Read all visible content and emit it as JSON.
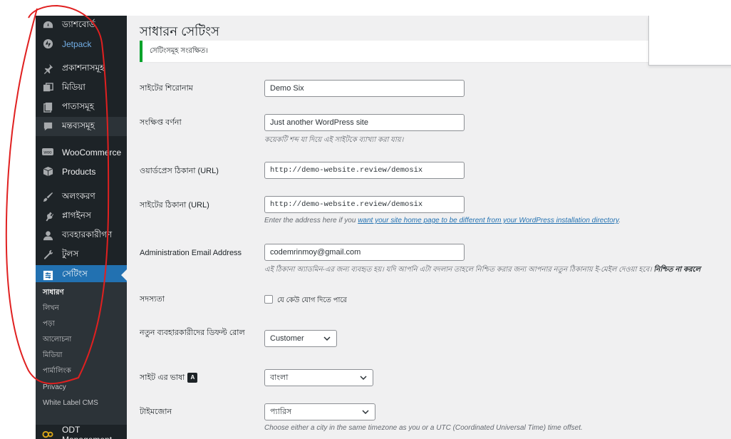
{
  "sidebar": {
    "items": [
      {
        "label": "ড্যাশবোর্ড",
        "icon": "dashboard-icon"
      },
      {
        "label": "Jetpack",
        "icon": "jetpack-icon"
      },
      {
        "label": "প্রকাশনাসমূহ",
        "icon": "pin-icon"
      },
      {
        "label": "মিডিয়া",
        "icon": "media-icon"
      },
      {
        "label": "পাতাসমূহ",
        "icon": "pages-icon"
      },
      {
        "label": "মন্তব্যসমূহ",
        "icon": "comments-icon"
      },
      {
        "label": "WooCommerce",
        "icon": "woocommerce-icon"
      },
      {
        "label": "Products",
        "icon": "products-icon"
      },
      {
        "label": "অলংকরণ",
        "icon": "appearance-icon"
      },
      {
        "label": "প্লাগইনস",
        "icon": "plugins-icon"
      },
      {
        "label": "ব্যবহারকারীগণ",
        "icon": "users-icon"
      },
      {
        "label": "টুলস",
        "icon": "tools-icon"
      },
      {
        "label": "সেটিংস",
        "icon": "settings-icon"
      },
      {
        "label": "ODT Management",
        "icon": "odt-icon"
      }
    ],
    "submenu": [
      "সাধারণ",
      "লিখন",
      "পড়া",
      "আলোচনা",
      "মিডিয়া",
      "পার্মালিংক",
      "Privacy",
      "White Label CMS"
    ]
  },
  "page": {
    "title": "সাধারন সেটিংস",
    "notice": "সেটিংসমূহ সংরক্ষিত।"
  },
  "form": {
    "site_title": {
      "label": "সাইটের শিরোনাম",
      "value": "Demo Six"
    },
    "tagline": {
      "label": "সংক্ষিপ্ত বর্ণনা",
      "value": "Just another WordPress site",
      "desc": "কয়েকটি শব্দ যা দিয়ে এই সাইটকে ব্যাখ্যা করা যায়।"
    },
    "wp_url": {
      "label": "ওয়ার্ডপ্রেস ঠিকানা (URL)",
      "value": "http://demo-website.review/demosix"
    },
    "site_url": {
      "label": "সাইটের ঠিকানা (URL)",
      "value": "http://demo-website.review/demosix",
      "desc_prefix": "Enter the address here if you ",
      "desc_link": "want your site home page to be different from your WordPress installation directory",
      "desc_suffix": "."
    },
    "admin_email": {
      "label": "Administration Email Address",
      "value": "codemrinmoy@gmail.com",
      "desc": "এই ঠিকানা অ্যাডমিন-এর জন্য ব্যবহৃত হয়। যদি আপনি এটা বদলান তাহলে নিশ্চিত করার জন্য আপনার নতুন ঠিকানায় ই-মেইল দেওয়া হবে। ",
      "desc_bold": "নিশ্চিত না করলে"
    },
    "membership": {
      "label": "সদস্যতা",
      "checkbox_label": "যে কেউ যোগ দিতে পারে"
    },
    "default_role": {
      "label": "নতুন ব্যবহারকারীদের ডিফল্ট রোল",
      "value": "Customer"
    },
    "language": {
      "label": "সাইট এর ভাষা",
      "value": "বাংলা"
    },
    "timezone": {
      "label": "টাইমজোন",
      "value": "প্যারিস",
      "desc": "Choose either a city in the same timezone as you or a UTC (Coordinated Universal Time) time offset."
    }
  },
  "colors": {
    "sidebar_bg": "#1d2327",
    "accent": "#2271b1",
    "notice_success": "#00a32a",
    "annotation": "#e02020"
  }
}
